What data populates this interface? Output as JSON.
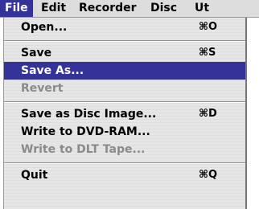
{
  "menubar": {
    "items": [
      "File",
      "Edit",
      "Recorder",
      "Disc",
      "Ut"
    ]
  },
  "file_menu": {
    "open": {
      "label": "Open...",
      "shortcut": "⌘O"
    },
    "save": {
      "label": "Save",
      "shortcut": "⌘S"
    },
    "save_as": {
      "label": "Save As..."
    },
    "revert": {
      "label": "Revert"
    },
    "save_disc_image": {
      "label": "Save as Disc Image...",
      "shortcut": "⌘D"
    },
    "write_dvd_ram": {
      "label": "Write to DVD-RAM..."
    },
    "write_dlt": {
      "label": "Write to DLT Tape..."
    },
    "quit": {
      "label": "Quit",
      "shortcut": "⌘Q"
    }
  },
  "colors": {
    "highlight": "#33339a",
    "disabled_text": "#8a8a8a"
  }
}
